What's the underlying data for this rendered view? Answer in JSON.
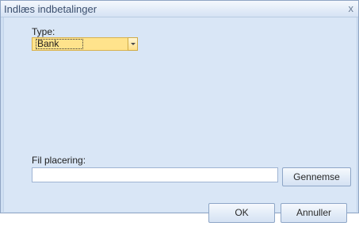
{
  "window": {
    "title": "Indlæs indbetalinger",
    "close_label": "x"
  },
  "type_field": {
    "label": "Type:",
    "value": "Bank"
  },
  "file_field": {
    "label": "Fil placering:",
    "value": ""
  },
  "buttons": {
    "browse": "Gennemse",
    "ok": "OK",
    "cancel": "Annuller"
  }
}
